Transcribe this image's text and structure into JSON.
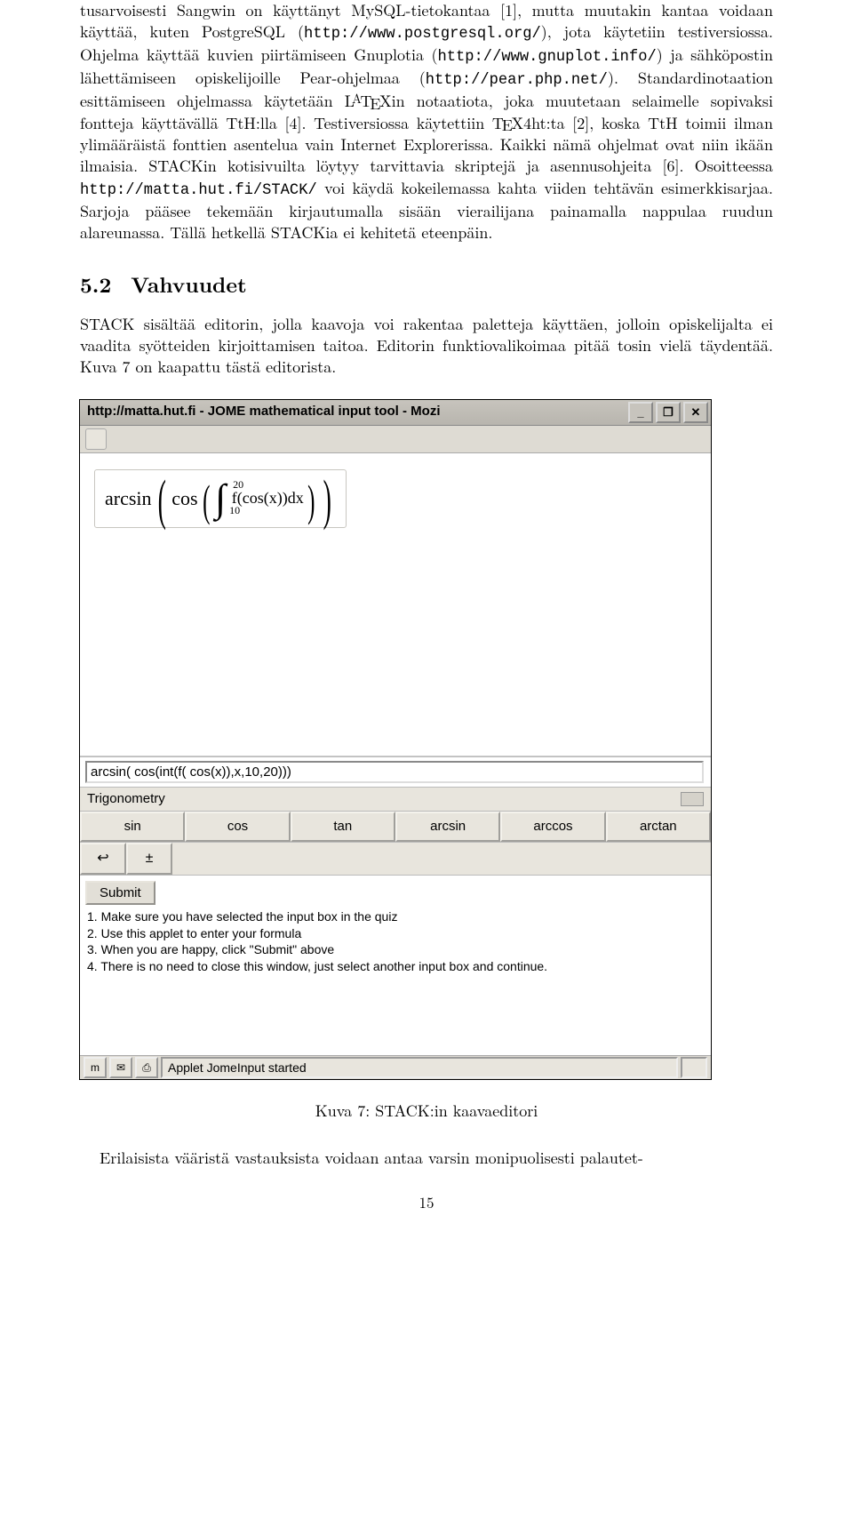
{
  "para1_a": "tusarvoisesti Sangwin on käyttänyt MySQL-tietokantaa [1], mutta muutakin kantaa voidaan käyttää, kuten PostgreSQL (",
  "url_pg": "http://www.postgresql.org/",
  "para1_b": "), jota käytetiin testiversiossa. Ohjelma käyttää kuvien piirtämiseen Gnuplotia (",
  "url_gp": "http://www.gnuplot.info/",
  "para1_c": ") ja sähköpostin lähettämiseen opiskelijoille Pear-ohjelmaa (",
  "url_pear": "http://pear.php.net/",
  "para1_d": "). Standardinotaation esittämiseen ohjelmassa käytetään ",
  "latex": "LATEX",
  "para1_e": "in notaatiota, joka muutetaan selaimelle sopivaksi fontteja käyttävällä TtH:lla [4]. Testiversiossa käytettiin ",
  "tex4ht": "TEX4ht",
  "para1_f": ":ta [2], koska TtH toimii ilman ylimääräistä fonttien asentelua vain Internet Explorerissa. Kaikki nämä ohjelmat ovat niin ikään ilmaisia. STACKin kotisivuilta löytyy tarvittavia skriptejä ja asennusohjeita [6]. Osoitteessa ",
  "url_stack": "http://matta.hut.fi/STACK/",
  "para1_g": " voi käydä kokeilemassa kahta viiden tehtävän esimerkkisarjaa. Sarjoja pääsee tekemään kirjautumalla sisään vierailijana painamalla nappulaa ruudun alareunassa. Tällä hetkellä STACKia ei kehitetä eteenpäin.",
  "section_num": "5.2",
  "section_title": "Vahvuudet",
  "para2": "STACK sisältää editorin, jolla kaavoja voi rakentaa paletteja käyttäen, jolloin opiskelijalta ei vaadita syötteiden kirjoittamisen taitoa. Editorin funktiovalikoimaa pitää tosin vielä täydentää. Kuva 7 on kaapattu tästä editorista.",
  "browser": {
    "title": "http://matta.hut.fi - JOME mathematical input tool - Mozi",
    "input_value": "arcsin( cos(int(f( cos(x)),x,10,20)))",
    "dropdown": "Trigonometry",
    "buttons": [
      "sin",
      "cos",
      "tan",
      "arcsin",
      "arccos",
      "arctan"
    ],
    "sym1": "↩",
    "sym2": "±",
    "submit": "Submit",
    "instr1": "1. Make sure you have selected the input box in the quiz",
    "instr2": "2. Use this applet to enter your formula",
    "instr3": "3. When you are happy, click \"Submit\" above",
    "instr4": "4. There is no need to close this window, just select another input box and continue.",
    "status": "Applet JomeInput started"
  },
  "caption": "Kuva 7: STACK:in kaavaeditori",
  "para3": "Erilaisista vääristä vastauksista voidaan antaa varsin monipuolisesti palautet-",
  "pagenum": "15"
}
